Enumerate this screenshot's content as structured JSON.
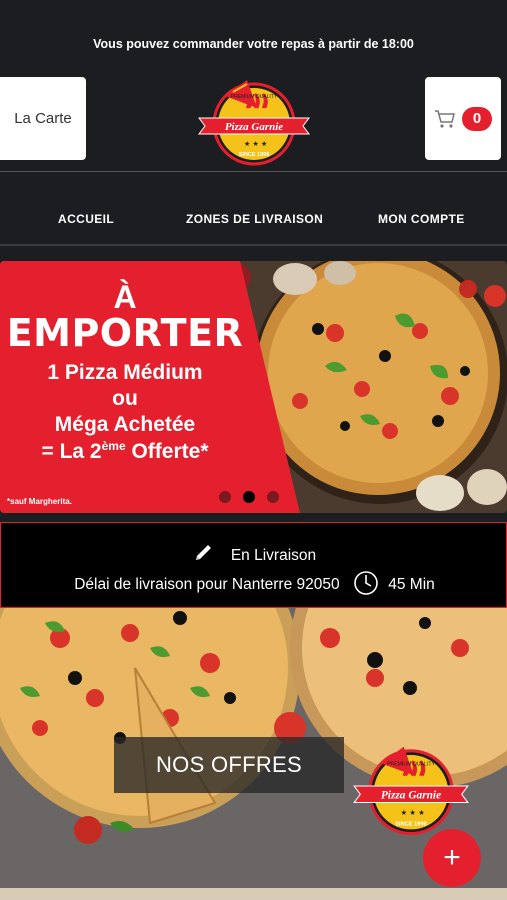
{
  "header": {
    "notice": "Vous pouvez commander votre repas à partir de 18:00",
    "menu_button": "La Carte",
    "cart_count": "0",
    "logo_top": "PREMIUM QUALITY",
    "logo_name": "Pizza Garnie",
    "logo_since": "SINCE 1998"
  },
  "nav": {
    "items": [
      "ACCUEIL",
      "ZONES DE LIVRAISON",
      "MON COMPTE"
    ]
  },
  "banner": {
    "line1": "À",
    "line2": "EMPORTER",
    "line3": "1 Pizza Médium",
    "line4": "ou",
    "line5": "Méga Achetée",
    "line6_prefix": "= La 2",
    "line6_sup": "ème",
    "line6_suffix": " Offerte*",
    "footnote": "*sauf Margherita.",
    "slide_count": 3,
    "active_slide": 1
  },
  "delivery": {
    "mode": "En Livraison",
    "delay_text": "Délai de livraison pour Nanterre 92050",
    "delay_value": "45 Min"
  },
  "offers": {
    "label": "NOS OFFRES"
  },
  "colors": {
    "background": "#1c1d21",
    "accent": "#e5202e",
    "white": "#ffffff"
  }
}
